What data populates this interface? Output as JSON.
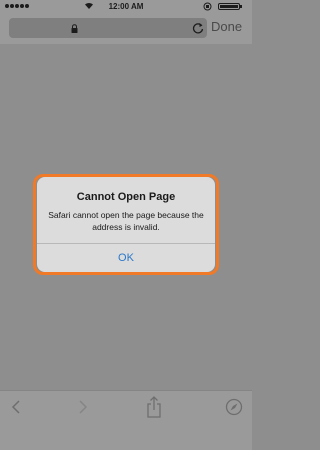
{
  "status_bar": {
    "time": "12:00 AM"
  },
  "nav_bar": {
    "done_label": "Done"
  },
  "alert": {
    "title": "Cannot Open Page",
    "message": "Safari cannot open the page because the address is invalid.",
    "ok_label": "OK"
  },
  "icons": {
    "lock": "lock-icon",
    "reload": "reload-icon",
    "back": "chevron-left-icon",
    "forward": "chevron-right-icon",
    "share": "share-icon",
    "bookmarks": "compass-icon"
  },
  "colors": {
    "highlight": "#f07a28",
    "ios_blue": "#2a78c8"
  }
}
